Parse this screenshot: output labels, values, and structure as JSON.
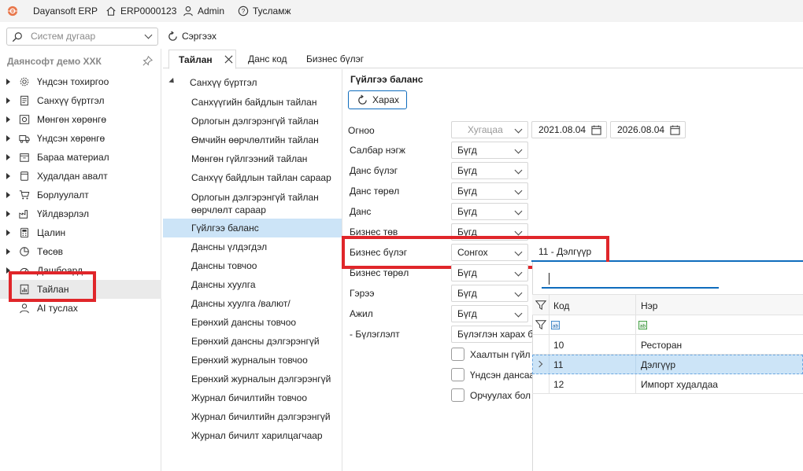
{
  "titlebar": {
    "app_name": "Dayansoft ERP",
    "db_code": "ERP0000123",
    "user": "Admin",
    "help": "Тусламж"
  },
  "toolbar": {
    "search_placeholder": "Систем дугаар",
    "refresh_label": "Сэргээх"
  },
  "sidebar": {
    "company": "Даянсофт демо ХХК",
    "items": [
      {
        "label": "Үндсэн тохиргоо",
        "icon": "gear-icon"
      },
      {
        "label": "Санхүү бүртгэл",
        "icon": "ledger-icon"
      },
      {
        "label": "Мөнгөн хөрөнгө",
        "icon": "money-icon"
      },
      {
        "label": "Үндсэн хөрөнгө",
        "icon": "truck-icon"
      },
      {
        "label": "Бараа материал",
        "icon": "box-icon"
      },
      {
        "label": "Худалдан авалт",
        "icon": "basket-icon"
      },
      {
        "label": "Борлуулалт",
        "icon": "cart-icon"
      },
      {
        "label": "Үйлдвэрлэл",
        "icon": "factory-icon"
      },
      {
        "label": "Цалин",
        "icon": "calculator-icon"
      },
      {
        "label": "Төсөв",
        "icon": "pie-chart-icon"
      },
      {
        "label": "Дашбоард",
        "icon": "dashboard-icon"
      },
      {
        "label": "Тайлан",
        "icon": "report-icon"
      },
      {
        "label": "AI туслах",
        "icon": "ai-assistant-icon"
      }
    ]
  },
  "tabs": [
    {
      "label": "Тайлан",
      "active": true
    },
    {
      "label": "Данс код",
      "active": false
    },
    {
      "label": "Бизнес бүлэг",
      "active": false
    }
  ],
  "tree": {
    "root": "Санхүү бүртгэл",
    "items": [
      "Санхүүгийн байдлын тайлан",
      "Орлогын дэлгэрэнгүй тайлан",
      "Өмчийн өөрчлөлтийн тайлан",
      "Мөнгөн гүйлгээний тайлан",
      "Санхүү байдлын тайлан сараар",
      "Орлогын дэлгэрэнгүй тайлан өөрчлөлт сараар",
      "Гүйлгээ баланс",
      "Дансны үлдэгдэл",
      "Дансны товчоо",
      "Дансны хуулга",
      "Дансны хуулга /валют/",
      "Ерөнхий дансны товчоо",
      "Ерөнхий дансны дэлгэрэнгүй",
      "Ерөнхий журналын товчоо",
      "Ерөнхий журналын дэлгэрэнгүй",
      "Журнал бичилтийн товчоо",
      "Журнал бичилтийн дэлгэрэнгүй",
      "Журнал бичилт харилцагчаар"
    ],
    "selected_index": 6
  },
  "report": {
    "title": "Гүйлгээ баланс",
    "view_button": "Харах",
    "date": {
      "label": "Огноо",
      "period": "Хугацаа",
      "from": "2021.08.04",
      "to": "2026.08.04"
    },
    "filters": [
      {
        "label": "Салбар нэгж",
        "value": "Бүгд"
      },
      {
        "label": "Данс бүлэг",
        "value": "Бүгд"
      },
      {
        "label": "Данс төрөл",
        "value": "Бүгд"
      },
      {
        "label": "Данс",
        "value": "Бүгд"
      },
      {
        "label": "Бизнес төв",
        "value": "Бүгд"
      },
      {
        "label": "Бизнес бүлэг",
        "value": "Сонгох",
        "selected": "11 - Дэлгүүр"
      },
      {
        "label": "Бизнес төрөл",
        "value": "Бүгд"
      },
      {
        "label": "Гэрээ",
        "value": "Бүгд"
      },
      {
        "label": "Ажил",
        "value": "Бүгд"
      }
    ],
    "grouping": {
      "label": "- Бүлэглэлт",
      "value": "Бүлэглэн харах бо"
    },
    "checkboxes": [
      "Хаалтын гүйл",
      "Үндсэн дансаа",
      "Орчуулах бол"
    ]
  },
  "dropdown_grid": {
    "search_value": "",
    "columns": [
      "Код",
      "Нэр"
    ],
    "rows": [
      {
        "code": "10",
        "name": "Ресторан"
      },
      {
        "code": "11",
        "name": "Дэлгүүр"
      },
      {
        "code": "12",
        "name": "Импорт худалдаа"
      }
    ],
    "selected_row": 1
  },
  "colors": {
    "highlight_red": "#e0262a",
    "selection_blue": "#cce4f7",
    "accent": "#0f6cbd"
  }
}
